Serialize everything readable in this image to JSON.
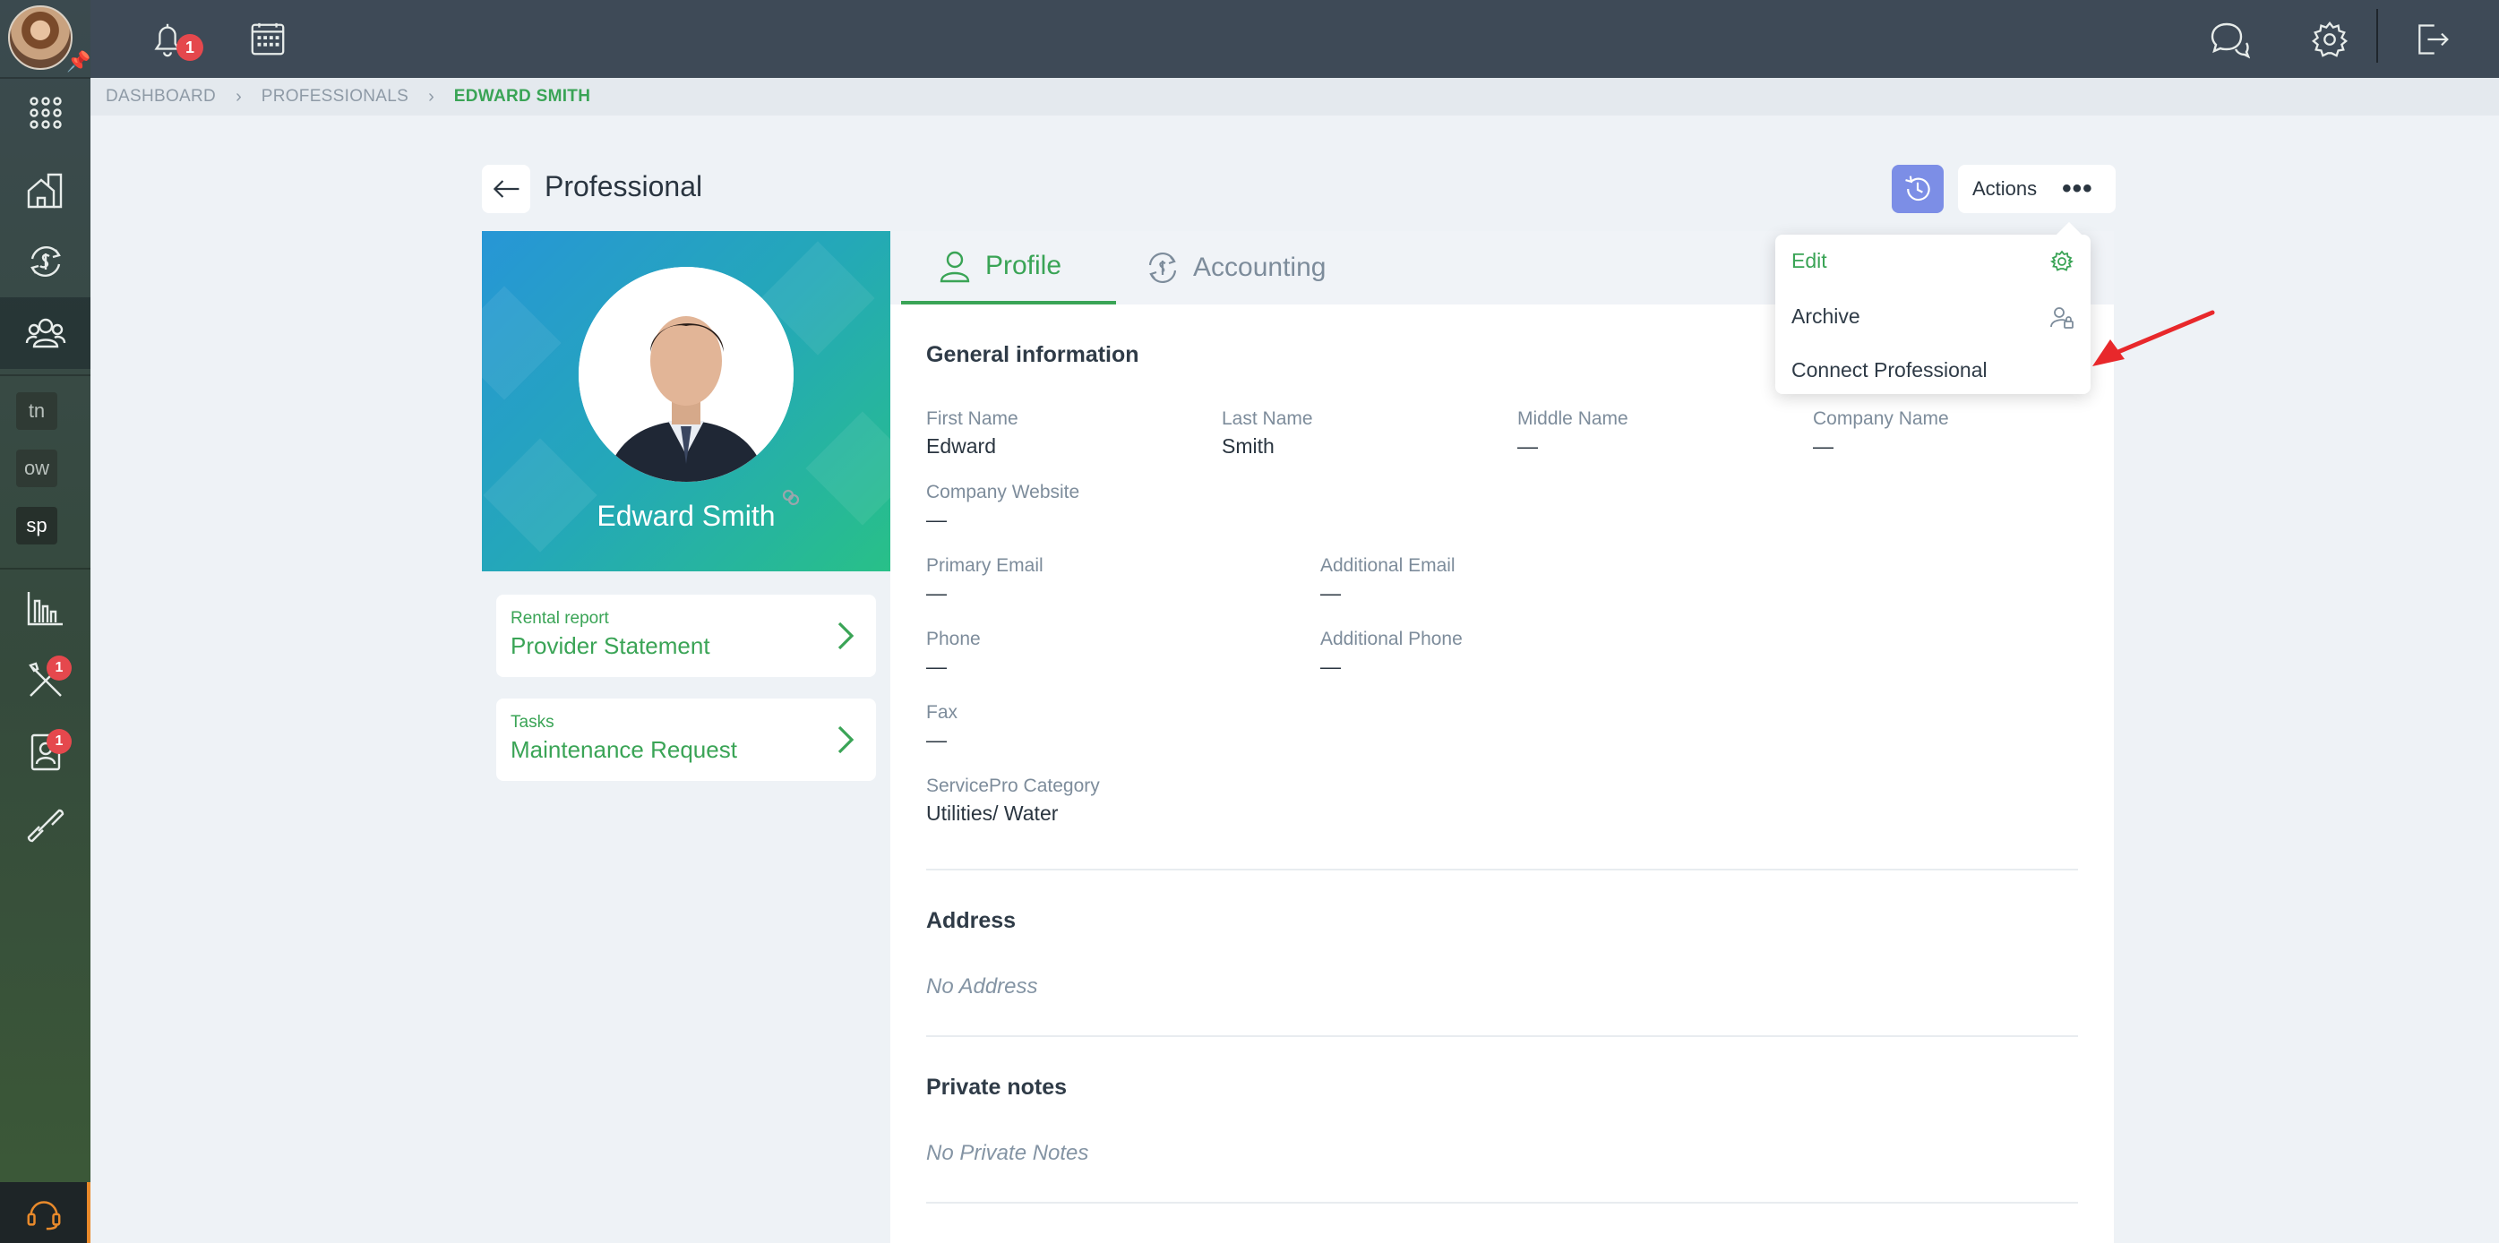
{
  "topbar": {
    "notification_count": "1"
  },
  "sidebar": {
    "tags": [
      "tn",
      "ow",
      "sp"
    ],
    "maintenance_badge": "1",
    "contacts_badge": "1"
  },
  "breadcrumb": [
    "DASHBOARD",
    "PROFESSIONALS",
    "EDWARD SMITH"
  ],
  "page": {
    "title": "Professional",
    "actions_label": "Actions",
    "actions_dots": "•••"
  },
  "profile": {
    "name": "Edward Smith"
  },
  "links": [
    {
      "small": "Rental report",
      "big": "Provider Statement"
    },
    {
      "small": "Tasks",
      "big": "Maintenance Request"
    }
  ],
  "tabs": [
    {
      "label": "Profile",
      "icon": "user-icon"
    },
    {
      "label": "Accounting",
      "icon": "accounting-icon"
    }
  ],
  "general": {
    "title": "General information",
    "first_name_label": "First Name",
    "first_name": "Edward",
    "last_name_label": "Last Name",
    "last_name": "Smith",
    "middle_name_label": "Middle Name",
    "middle_name": "—",
    "company_name_label": "Company Name",
    "company_name": "—",
    "company_website_label": "Company Website",
    "company_website": "—",
    "primary_email_label": "Primary Email",
    "primary_email": "—",
    "additional_email_label": "Additional Email",
    "additional_email": "—",
    "phone_label": "Phone",
    "phone": "—",
    "additional_phone_label": "Additional Phone",
    "additional_phone": "—",
    "fax_label": "Fax",
    "fax": "—",
    "category_label": "ServicePro Category",
    "category": "Utilities/ Water"
  },
  "address": {
    "title": "Address",
    "empty": "No Address"
  },
  "notes": {
    "title": "Private notes",
    "empty": "No Private Notes"
  },
  "dropdown": {
    "items": [
      {
        "label": "Edit",
        "icon": "gear-icon"
      },
      {
        "label": "Archive",
        "icon": "user-lock-icon"
      },
      {
        "label": "Connect Professional"
      }
    ]
  },
  "colors": {
    "accent": "#3aa456",
    "topbar": "#3e4a57",
    "history_button": "#7c8ee6",
    "badge": "#e5484d",
    "annotation_arrow": "#e8282b"
  }
}
